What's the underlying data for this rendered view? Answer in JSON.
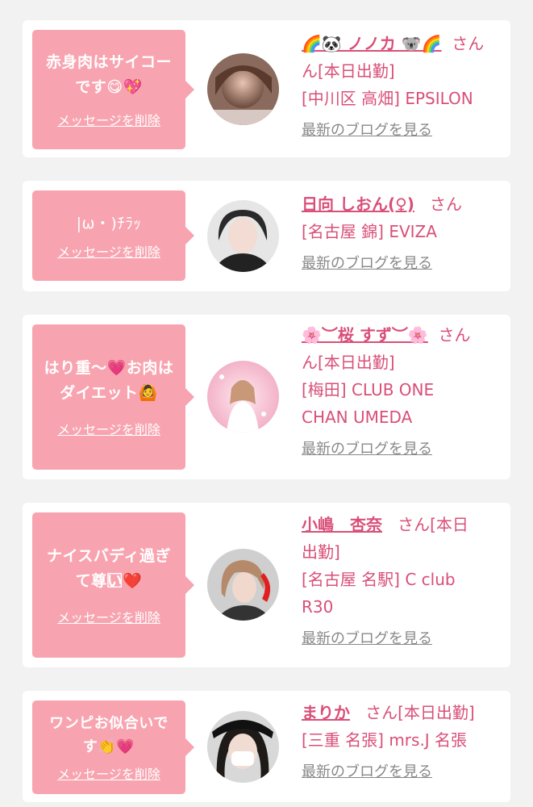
{
  "delete_label": "メッセージを削除",
  "blog_label": "最新のブログを見る",
  "san_label": "さん",
  "colors": {
    "accent": "#d94f78",
    "bubble": "#f8a4b0",
    "link_gray": "#888888"
  },
  "cards": [
    {
      "message_line1": "赤身肉はサイコー",
      "message_line2": "です😋💖",
      "name": "🌈🐼 ノノカ 🐨🌈",
      "status": "ん[本日出勤]",
      "shop": "[中川区 高畑] EPSILON"
    },
    {
      "message_line1": "|ω・)ﾁﾗｯ",
      "name": "日向 しおん(♀)",
      "shop": "[名古屋 錦] EVIZA"
    },
    {
      "message_line1": "はり重〜💗お肉は",
      "message_line2": "ダイエット🙆",
      "name": "🌸︶桜 すず︶🌸",
      "status": "ん[本日出勤]",
      "shop_line1": "[梅田] CLUB ONE",
      "shop_line2": "CHAN UMEDA"
    },
    {
      "message_line1": "ナイスバディ過ぎ",
      "message_line2": "て尊い⃞❤️",
      "name": "小嶋　杏奈",
      "san_status": "さん[本日",
      "status": "出勤]",
      "shop_line1": "[名古屋 名駅] C club",
      "shop_line2": "R30"
    },
    {
      "message_line1": "ワンピお似合いで",
      "message_line2": "す👏💗",
      "name": "まりか",
      "san_status": "さん[本日出勤]",
      "shop": "[三重 名張] mrs.J 名張"
    }
  ]
}
